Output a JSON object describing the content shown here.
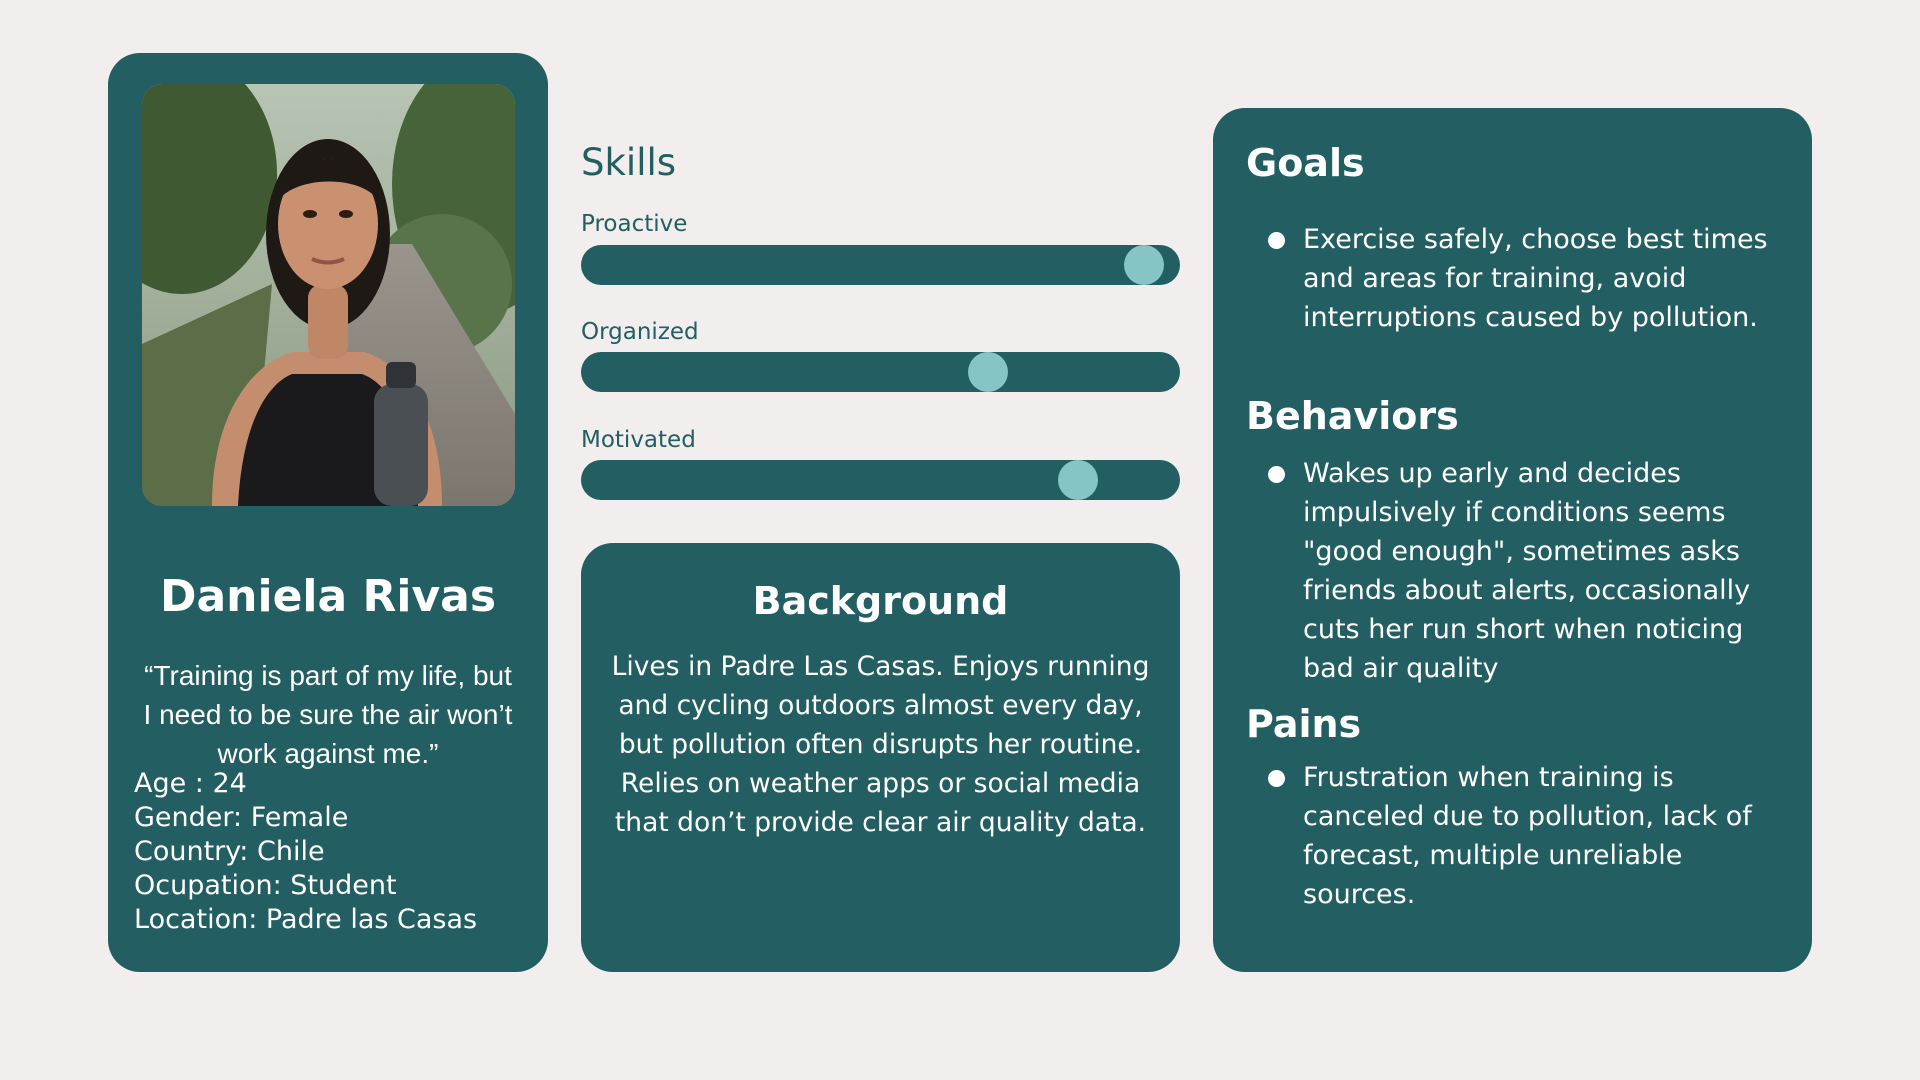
{
  "persona": {
    "name": "Daniela Rivas",
    "quote": "“Training is part of my life, but I need to be sure the air won’t work against me.”",
    "demographics": [
      "Age : 24",
      "Gender: Female",
      "Country: Chile",
      "Ocupation: Student",
      "Location: Padre las Casas"
    ]
  },
  "skills": {
    "title": "Skills",
    "items": [
      {
        "label": "Proactive",
        "level": 0.94
      },
      {
        "label": "Organized",
        "level": 0.68
      },
      {
        "label": "Motivated",
        "level": 0.83
      }
    ]
  },
  "background": {
    "title": "Background",
    "text": "Lives in Padre Las Casas. Enjoys running and cycling outdoors almost every day, but pollution often disrupts her routine. Relies on weather apps or social media that don’t provide clear air quality data."
  },
  "goals": {
    "title": "Goals",
    "items": [
      "Exercise safely, choose best times and areas for training, avoid interruptions caused by pollution."
    ]
  },
  "behaviors": {
    "title": "Behaviors",
    "items": [
      "Wakes up early and decides impulsively if conditions seems \"good enough\", sometimes asks friends about alerts, occasionally cuts her run short when noticing bad air quality"
    ]
  },
  "pains": {
    "title": "Pains",
    "items": [
      "Frustration when training is canceled due to pollution, lack of forecast, multiple unreliable sources."
    ]
  },
  "colors": {
    "card": "#225e62",
    "page_background": "#f1eeed",
    "slider_knob": "#86c4c6",
    "text_on_card": "#ffffff"
  }
}
